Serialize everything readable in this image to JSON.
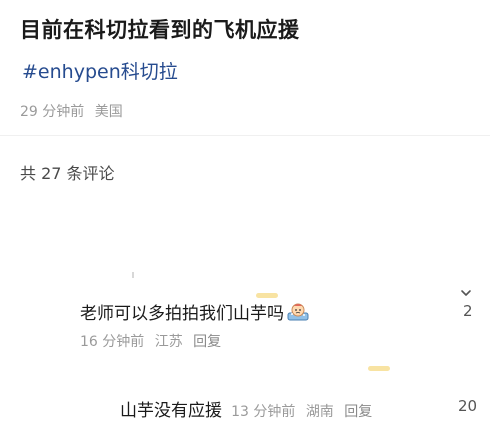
{
  "post": {
    "title": "目前在科切拉看到的飞机应援",
    "hashtag": "#enhypen科切拉",
    "time": "29 分钟前",
    "location": "美国"
  },
  "comments_header": {
    "count_text": "共 27 条评论"
  },
  "comments": [
    {
      "text": "老师可以多拍拍我们山芋吗",
      "sticker_icon": "crying-bath-sticker-icon",
      "time": "16 分钟前",
      "location": "江苏",
      "reply_label": "回复",
      "likes": "2",
      "expand_icon": "chevron-down-icon"
    },
    {
      "text": "山芋没有应援",
      "time": "13 分钟前",
      "location": "湖南",
      "reply_label": "回复",
      "likes": "20"
    }
  ],
  "colors": {
    "hashtag": "#264b8f",
    "meta_text": "#9a9a9a",
    "title_text": "#1a1a1a"
  }
}
